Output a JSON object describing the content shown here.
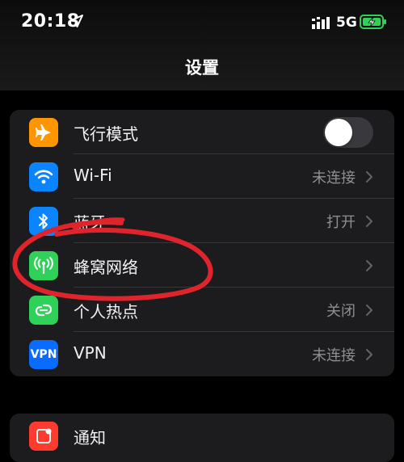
{
  "status_bar": {
    "time": "20:18",
    "network": "5G",
    "icons": [
      "location-arrow-icon",
      "signal-bars-icon",
      "battery-charging-icon"
    ]
  },
  "header": {
    "title": "设置"
  },
  "settings": [
    {
      "label": "飞行模式",
      "icon": "airplane-icon",
      "icon_color": "#ff9500",
      "type": "toggle",
      "toggle_on": false
    },
    {
      "label": "Wi-Fi",
      "icon": "wifi-icon",
      "icon_color": "#0a84ff",
      "value": "未连接",
      "type": "link"
    },
    {
      "label": "蓝牙",
      "icon": "bluetooth-icon",
      "icon_color": "#0a84ff",
      "value": "打开",
      "type": "link"
    },
    {
      "label": "蜂窝网络",
      "icon": "antenna-icon",
      "icon_color": "#30d158",
      "value": "",
      "type": "link"
    },
    {
      "label": "个人热点",
      "icon": "hotspot-icon",
      "icon_color": "#30d158",
      "value": "关闭",
      "type": "link"
    },
    {
      "label": "VPN",
      "icon": "vpn-icon",
      "icon_text": "VPN",
      "icon_color": "#0a6cff",
      "value": "未连接",
      "type": "link"
    }
  ],
  "second_group": [
    {
      "label": "通知",
      "icon": "notifications-icon",
      "icon_color": "#ff3b30"
    }
  ],
  "colors": {
    "annotation": "#e0242c",
    "group_bg": "#1c1c1e",
    "secondary_text": "#8e8e93"
  }
}
